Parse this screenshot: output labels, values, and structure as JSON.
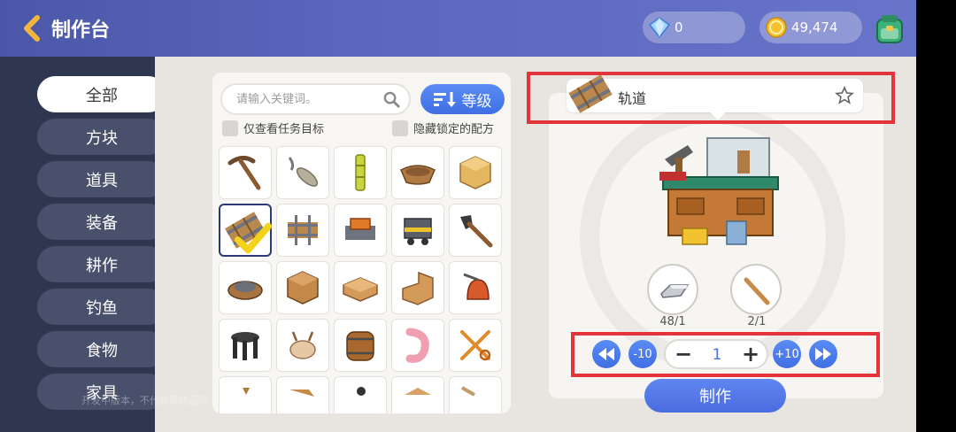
{
  "header": {
    "title": "制作台",
    "diamonds": "0",
    "coins": "49,474"
  },
  "sidebar": {
    "items": [
      {
        "label": "全部",
        "active": true
      },
      {
        "label": "方块"
      },
      {
        "label": "道具"
      },
      {
        "label": "装备"
      },
      {
        "label": "耕作"
      },
      {
        "label": "钓鱼"
      },
      {
        "label": "食物"
      },
      {
        "label": "家具"
      }
    ]
  },
  "search": {
    "placeholder": "请输入关键词。",
    "sort_label": "等级"
  },
  "filters": {
    "task_only": "仅查看任务目标",
    "hide_locked": "隐藏锁定的配方"
  },
  "grid": {
    "items": [
      "pickaxe",
      "fishing-rod",
      "bamboo",
      "boat",
      "wood-block",
      "rail",
      "rail-cross",
      "powered-rail",
      "minecart",
      "shovel",
      "barrel-boat",
      "crate",
      "wood-slab",
      "wood-stairs",
      "bell",
      "stool",
      "bird-hat",
      "barrel",
      "shrimp",
      "scissors",
      "partial-1",
      "partial-2",
      "partial-3",
      "partial-4",
      "partial-5"
    ]
  },
  "detail": {
    "name": "轨道",
    "materials": [
      {
        "name": "iron-ingot-icon",
        "count": "48/1"
      },
      {
        "name": "stick-icon",
        "count": "2/1"
      }
    ],
    "quantity": "1",
    "minus10": "-10",
    "plus10": "+10",
    "craft_label": "制作"
  },
  "watermark": "开发中版本，不代表最终品质",
  "colors": {
    "header": "#5b67bd",
    "sidebar": "#2e3650",
    "accent": "#4a73d8",
    "highlight": "#e2343a"
  }
}
